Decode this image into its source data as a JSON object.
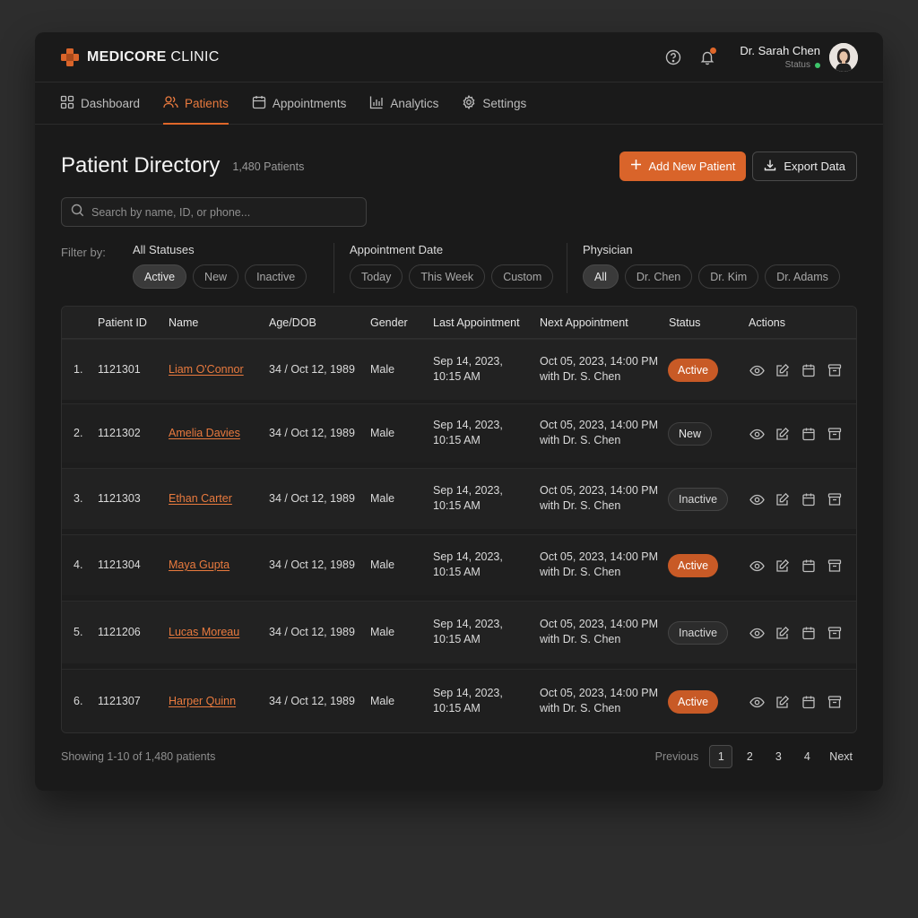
{
  "brand": {
    "name_bold": "MEDICORE",
    "name_rest": " CLINIC"
  },
  "user": {
    "name": "Dr. Sarah Chen",
    "status_label": "Status"
  },
  "nav": [
    {
      "label": "Dashboard",
      "icon": "grid-icon"
    },
    {
      "label": "Patients",
      "icon": "users-icon",
      "active": true
    },
    {
      "label": "Appointments",
      "icon": "calendar-icon"
    },
    {
      "label": "Analytics",
      "icon": "bar-chart-icon"
    },
    {
      "label": "Settings",
      "icon": "gear-icon"
    }
  ],
  "page": {
    "title": "Patient Directory",
    "count": "1,480 Patients"
  },
  "buttons": {
    "add": "Add New Patient",
    "export": "Export Data"
  },
  "search": {
    "placeholder": "Search by name, ID, or phone..."
  },
  "filters": {
    "label": "Filter by:",
    "status": {
      "title": "All Statuses",
      "options": [
        "Active",
        "New",
        "Inactive"
      ],
      "selected": "Active"
    },
    "date": {
      "title": "Appointment Date",
      "options": [
        "Today",
        "This Week",
        "Custom"
      ]
    },
    "physician": {
      "title": "Physician",
      "options": [
        "All",
        "Dr. Chen",
        "Dr. Kim",
        "Dr. Adams"
      ],
      "selected": "All"
    }
  },
  "table": {
    "columns": [
      "Patient ID",
      "Name",
      "Age/DOB",
      "Gender",
      "Last Appointment",
      "Next Appointment",
      "Status",
      "Actions"
    ],
    "rows": [
      {
        "num": "1.",
        "id": "1121301",
        "name": "Liam O'Connor",
        "age": "34 / Oct 12, 1989",
        "gender": "Male",
        "last1": "Sep 14, 2023,",
        "last2": "10:15 AM",
        "next1": "Oct 05, 2023, 14:00 PM",
        "next2": "with Dr. S. Chen",
        "status": "Active"
      },
      {
        "num": "2.",
        "id": "1121302",
        "name": "Amelia Davies",
        "age": "34 / Oct 12, 1989",
        "gender": "Male",
        "last1": "Sep 14, 2023,",
        "last2": "10:15 AM",
        "next1": "Oct 05, 2023, 14:00 PM",
        "next2": "with Dr. S. Chen",
        "status": "New"
      },
      {
        "num": "3.",
        "id": "1121303",
        "name": "Ethan Carter",
        "age": "34 / Oct 12, 1989",
        "gender": "Male",
        "last1": "Sep 14, 2023,",
        "last2": "10:15 AM",
        "next1": "Oct 05, 2023, 14:00 PM",
        "next2": "with Dr. S. Chen",
        "status": "Inactive"
      },
      {
        "num": "4.",
        "id": "1121304",
        "name": "Maya Gupta",
        "age": "34 / Oct 12, 1989",
        "gender": "Male",
        "last1": "Sep 14, 2023,",
        "last2": "10:15 AM",
        "next1": "Oct 05, 2023, 14:00 PM",
        "next2": "with Dr. S. Chen",
        "status": "Active"
      },
      {
        "num": "5.",
        "id": "1121206",
        "name": "Lucas Moreau",
        "age": "34 / Oct 12, 1989",
        "gender": "Male",
        "last1": "Sep 14, 2023,",
        "last2": "10:15 AM",
        "next1": "Oct 05, 2023, 14:00 PM",
        "next2": "with Dr. S. Chen",
        "status": "Inactive"
      },
      {
        "num": "6.",
        "id": "1121307",
        "name": "Harper Quinn",
        "age": "34 / Oct 12, 1989",
        "gender": "Male",
        "last1": "Sep 14, 2023,",
        "last2": "10:15 AM",
        "next1": "Oct 05, 2023, 14:00 PM",
        "next2": "with Dr. S. Chen",
        "status": "Active"
      }
    ]
  },
  "footer": {
    "showing": "Showing 1-10 of 1,480 patients",
    "previous": "Previous",
    "pages": [
      "1",
      "2",
      "3",
      "4"
    ],
    "current": "1",
    "next": "Next"
  },
  "colors": {
    "accent": "#d9642a",
    "accent_text": "#e97a3e",
    "online": "#3dc46a",
    "background": "#1a1a1a"
  }
}
